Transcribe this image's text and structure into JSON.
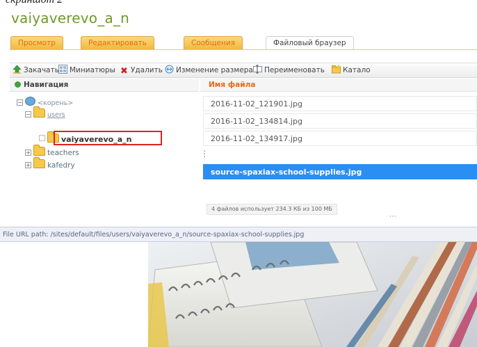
{
  "caption": "скриншот 2",
  "site_title": "vaiyaverevo_a_n",
  "tabs": [
    {
      "label": "Просмотр",
      "active": false
    },
    {
      "label": "Редактировать",
      "active": false
    },
    {
      "label": "Сообщения",
      "active": false
    },
    {
      "label": "Файловый браузер",
      "active": true
    }
  ],
  "toolbar": {
    "upload": "Закачать",
    "thumbnails": "Миниатюры",
    "delete": "Удалить",
    "resize": "Изменение размера",
    "rename": "Переименовать",
    "catalog": "Катало"
  },
  "navigation": {
    "title": "Навигация",
    "root": "<корень>",
    "users": "users",
    "current_user": "vaiyaverevo_a_n",
    "teachers": "teachers",
    "kafedry": "kafedry"
  },
  "file_list": {
    "header": "Имя файла",
    "files": [
      "2016-11-02_121901.jpg",
      "2016-11-02_134814.jpg",
      "2016-11-02_134917.jpg",
      "source-spaxiax-school-supplies.jpg"
    ],
    "selected_index": 3,
    "usage": "4 файлов использует 234.3 КБ из 100 МБ"
  },
  "url_path": "File URL path: /sites/default/files/users/vaiyaverevo_a_n/source-spaxiax-school-supplies.jpg",
  "colors": {
    "accent_green": "#6f9a2a",
    "tab_orange": "#f2b73c",
    "selection_blue": "#2b8ef2",
    "highlight_red": "#e02020"
  }
}
